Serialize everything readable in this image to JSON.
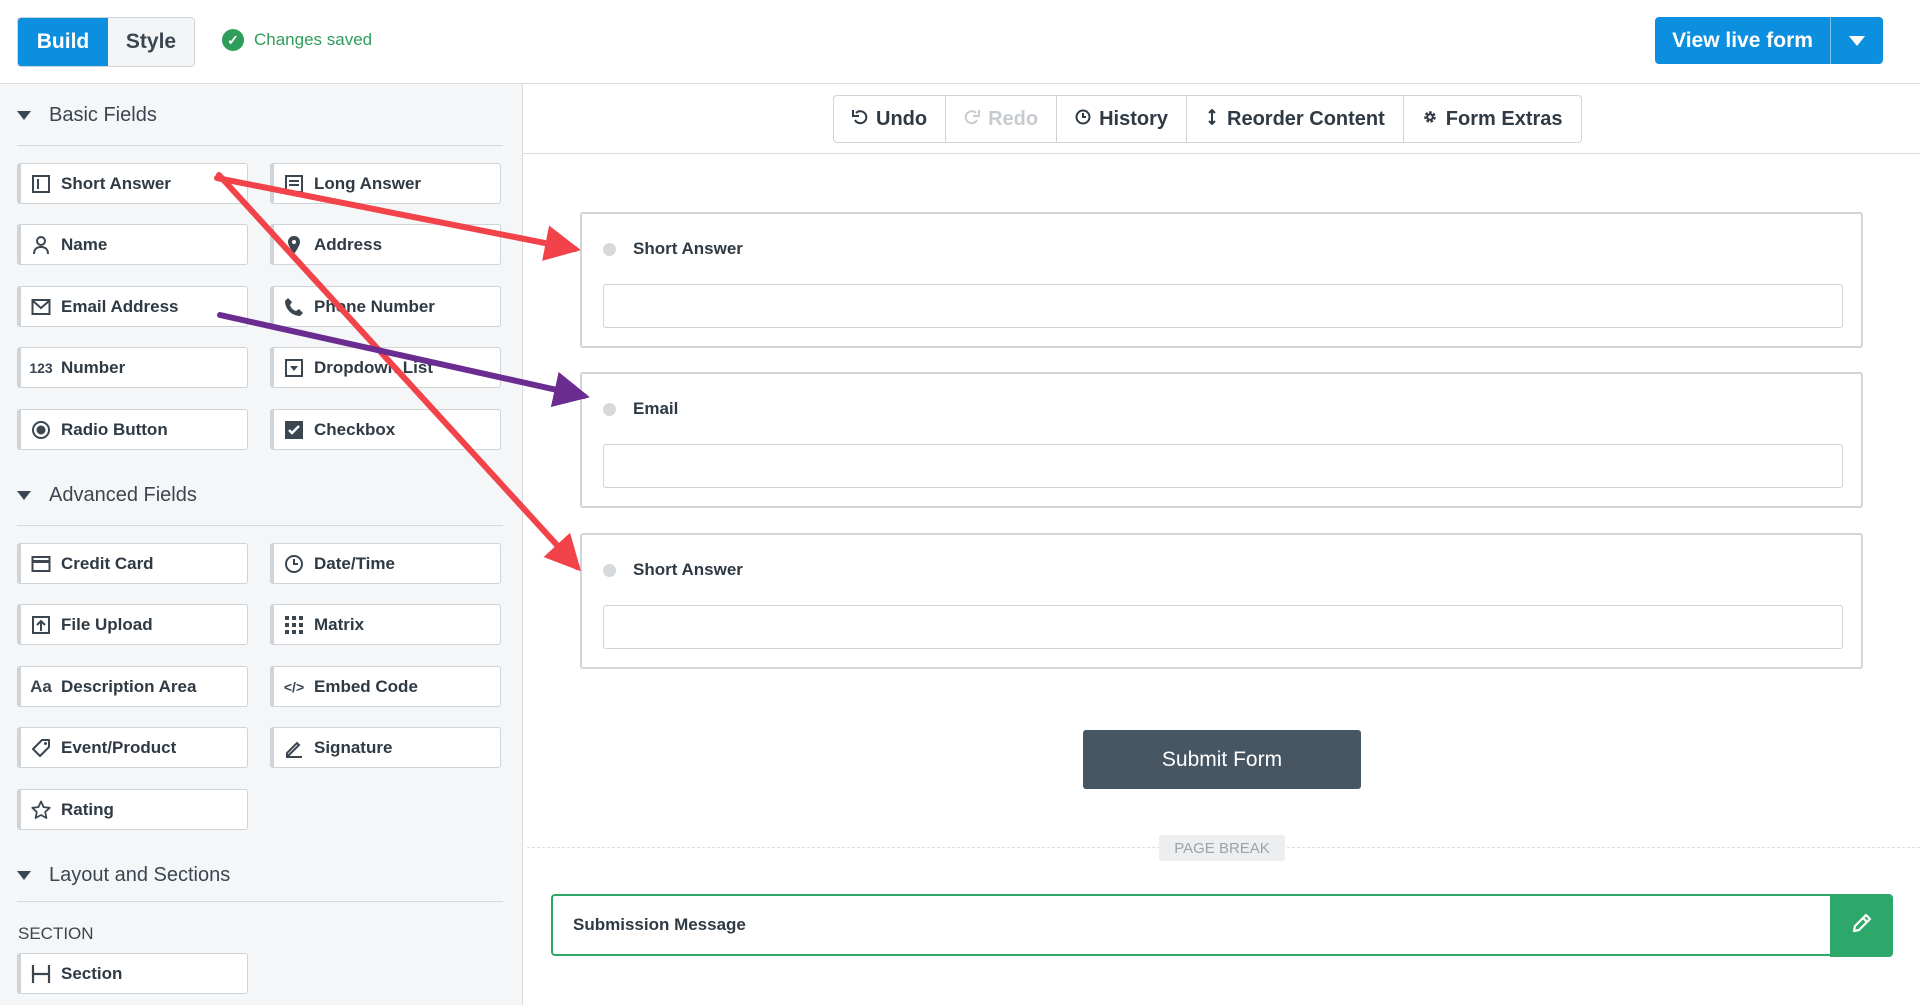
{
  "topbar": {
    "tabs": [
      "Build",
      "Style"
    ],
    "status": "Changes saved",
    "view_live": "View live form"
  },
  "sidebar": {
    "basic_title": "Basic Fields",
    "basic": [
      {
        "label": "Short Answer",
        "icon": "short-answer-icon"
      },
      {
        "label": "Long Answer",
        "icon": "long-answer-icon"
      },
      {
        "label": "Name",
        "icon": "person-icon"
      },
      {
        "label": "Address",
        "icon": "map-pin-icon"
      },
      {
        "label": "Email Address",
        "icon": "envelope-icon"
      },
      {
        "label": "Phone Number",
        "icon": "phone-icon"
      },
      {
        "label": "Number",
        "icon": "number-icon"
      },
      {
        "label": "Dropdown List",
        "icon": "dropdown-icon"
      },
      {
        "label": "Radio Button",
        "icon": "radio-icon"
      },
      {
        "label": "Checkbox",
        "icon": "checkbox-icon"
      }
    ],
    "advanced_title": "Advanced Fields",
    "advanced": [
      {
        "label": "Credit Card",
        "icon": "credit-card-icon"
      },
      {
        "label": "Date/Time",
        "icon": "clock-icon"
      },
      {
        "label": "File Upload",
        "icon": "file-upload-icon"
      },
      {
        "label": "Matrix",
        "icon": "matrix-icon"
      },
      {
        "label": "Description Area",
        "icon": "text-icon"
      },
      {
        "label": "Embed Code",
        "icon": "code-icon"
      },
      {
        "label": "Event/Product",
        "icon": "tag-icon"
      },
      {
        "label": "Signature",
        "icon": "pen-icon"
      },
      {
        "label": "Rating",
        "icon": "star-icon"
      }
    ],
    "layout_title": "Layout and Sections",
    "section_label": "SECTION",
    "layout": [
      {
        "label": "Section",
        "icon": "section-icon"
      }
    ]
  },
  "toolbar": [
    {
      "label": "Undo",
      "icon": "undo-icon",
      "disabled": false
    },
    {
      "label": "Redo",
      "icon": "redo-icon",
      "disabled": true
    },
    {
      "label": "History",
      "icon": "history-icon",
      "disabled": false
    },
    {
      "label": "Reorder Content",
      "icon": "reorder-icon",
      "disabled": false
    },
    {
      "label": "Form Extras",
      "icon": "gear-icon",
      "disabled": false
    }
  ],
  "form": {
    "fields": [
      {
        "label": "Short Answer",
        "value": ""
      },
      {
        "label": "Email",
        "value": ""
      },
      {
        "label": "Short Answer",
        "value": ""
      }
    ],
    "submit": "Submit Form",
    "page_break": "PAGE BREAK",
    "submission_message": "Submission Message"
  },
  "colors": {
    "primary": "#0d8fe0",
    "success": "#2e9e5a",
    "arrow_red": "#f2424a",
    "arrow_purple": "#6b2c91",
    "submit_bg": "#465663"
  }
}
